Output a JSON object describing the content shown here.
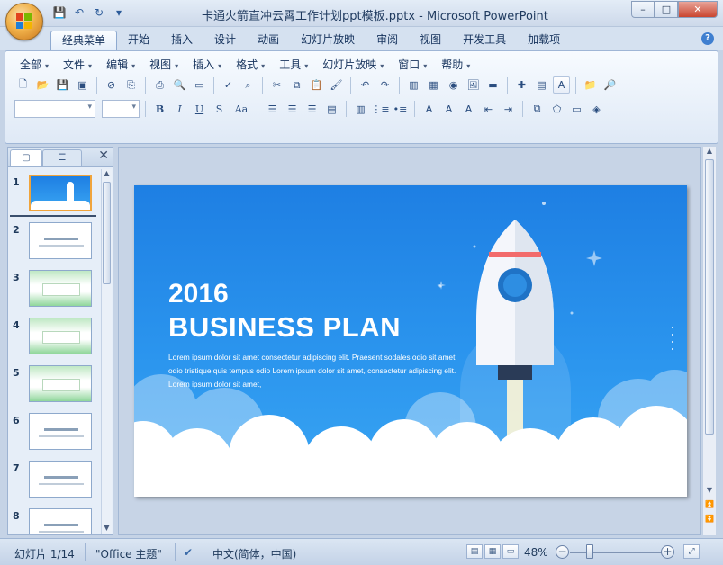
{
  "window": {
    "title": "卡通火箭直冲云霄工作计划ppt模板.pptx - Microsoft PowerPoint",
    "minimize": "–",
    "maximize": "□",
    "close": "✕"
  },
  "quick_access": [
    "save-icon",
    "undo-icon",
    "redo-icon",
    "customize-icon"
  ],
  "ribbon_tabs": [
    "经典菜单",
    "开始",
    "插入",
    "设计",
    "动画",
    "幻灯片放映",
    "审阅",
    "视图",
    "开发工具",
    "加载项"
  ],
  "active_tab": "经典菜单",
  "menus": [
    "全部",
    "文件",
    "编辑",
    "视图",
    "插入",
    "格式",
    "工具",
    "幻灯片放映",
    "窗口",
    "帮助"
  ],
  "help_label": "?",
  "panel": {
    "close_label": "✕",
    "slides": [
      {
        "num": "1",
        "style": "blue"
      },
      {
        "num": "2",
        "style": "white"
      },
      {
        "num": "3",
        "style": "green"
      },
      {
        "num": "4",
        "style": "green"
      },
      {
        "num": "5",
        "style": "green"
      },
      {
        "num": "6",
        "style": "white"
      },
      {
        "num": "7",
        "style": "white"
      },
      {
        "num": "8",
        "style": "white"
      }
    ],
    "selected": 1
  },
  "slide": {
    "year": "2016",
    "title": "BUSINESS  PLAN",
    "body": "Lorem ipsum dolor sit amet consectetur adipiscing elit. Praesent sodales odio sit amet odio tristique quis tempus odio Lorem ipsum dolor sit amet, consectetur adipiscing elit. Lorem ipsum dolor sit amet,"
  },
  "status": {
    "slide_info": "幻灯片 1/14",
    "theme": "\"Office 主题\"",
    "language": "中文(简体，中国)",
    "zoom": "48%",
    "zoom_minus": "−",
    "zoom_plus": "+"
  },
  "colors": {
    "slide_bg": "#2b95ee",
    "selection": "#f0a43c",
    "accent": "#2d5c9a"
  }
}
